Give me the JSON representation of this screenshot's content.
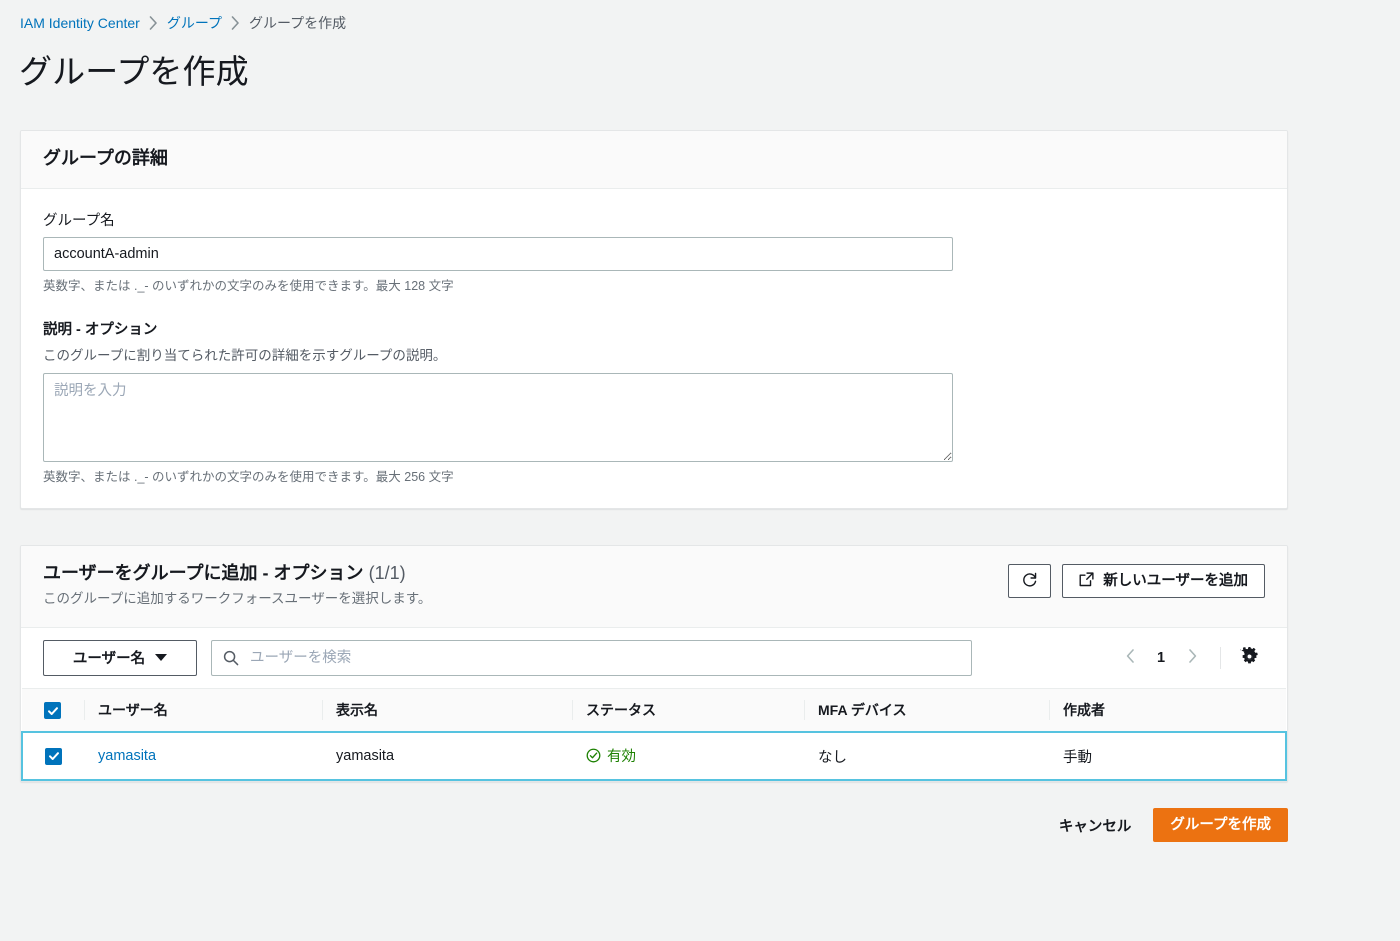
{
  "breadcrumb": {
    "items": [
      {
        "label": "IAM Identity Center",
        "type": "link"
      },
      {
        "label": "グループ",
        "type": "link"
      },
      {
        "label": "グループを作成",
        "type": "current"
      }
    ]
  },
  "page": {
    "title": "グループを作成"
  },
  "details_card": {
    "title": "グループの詳細",
    "group_name": {
      "label": "グループ名",
      "value": "accountA-admin",
      "placeholder": "",
      "hint": "英数字、または ._- のいずれかの文字のみを使用できます。最大 128 文字"
    },
    "description": {
      "label": "説明 - オプション",
      "desc": "このグループに割り当てられた許可の詳細を示すグループの説明。",
      "value": "",
      "placeholder": "説明を入力",
      "hint": "英数字、または ._- のいずれかの文字のみを使用できます。最大 256 文字"
    }
  },
  "users_card": {
    "title": "ユーザーをグループに追加 - オプション",
    "counter": "(1/1)",
    "subtitle": "このグループに追加するワークフォースユーザーを選択します。",
    "refresh_label": "",
    "add_user_label": "新しいユーザーを追加",
    "filter": {
      "dropdown_label": "ユーザー名",
      "search_value": "",
      "search_placeholder": "ユーザーを検索"
    },
    "pagination": {
      "current_page": "1"
    },
    "table": {
      "columns": [
        "ユーザー名",
        "表示名",
        "ステータス",
        "MFA デバイス",
        "作成者"
      ],
      "rows": [
        {
          "selected": true,
          "username": "yamasita",
          "display_name": "yamasita",
          "status": "有効",
          "mfa_device": "なし",
          "created_by": "手動"
        }
      ]
    }
  },
  "footer": {
    "cancel_label": "キャンセル",
    "submit_label": "グループを作成"
  },
  "colors": {
    "page_background": "#f2f3f3",
    "link": "#0073bb",
    "primary_button": "#ec7211",
    "status_success": "#1d8102",
    "row_selected_border": "#56c3e0",
    "row_selected_background": "#f1faff",
    "checkbox": "#0073bb"
  },
  "icons": {
    "chevron_right": "chevron-right-icon",
    "refresh": "refresh-icon",
    "external_link": "external-link-icon",
    "search": "search-icon",
    "gear": "gear-icon",
    "status_check": "check-circle-icon",
    "caret_down": "chevron-down-icon",
    "pager_prev": "chevron-left-icon",
    "pager_next": "chevron-right-icon"
  }
}
